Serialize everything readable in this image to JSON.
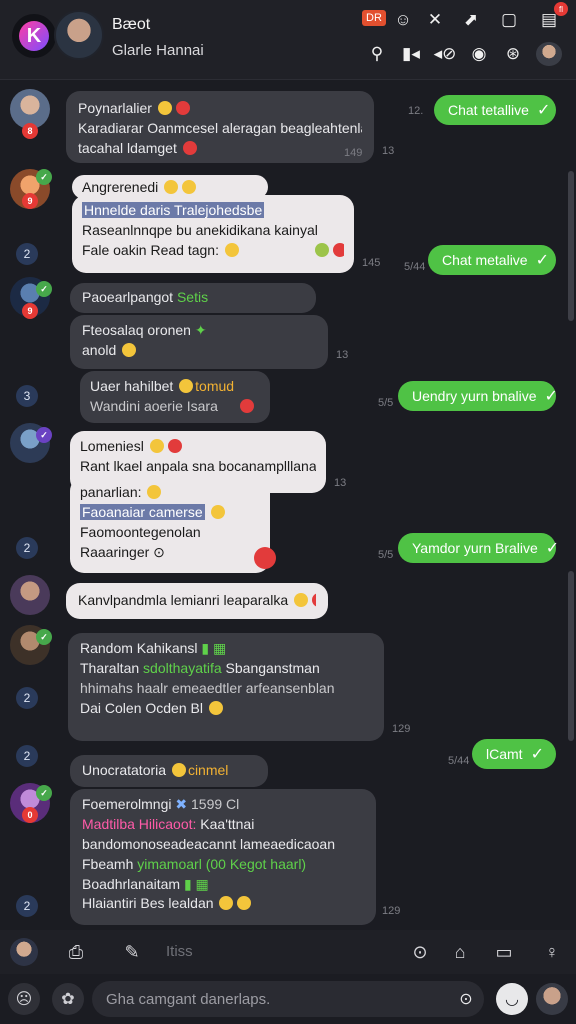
{
  "header": {
    "title": "Bæot",
    "subtitle": "Glarle Hannai",
    "tag": "DR",
    "notif_count": "fl",
    "icons": [
      "tag-icon",
      "emoji-icon",
      "tools-icon",
      "arrow-icon",
      "window-icon",
      "notification-icon",
      "search-icon",
      "video-icon",
      "mute-icon",
      "status-icon",
      "settings-icon",
      "profile-icon"
    ]
  },
  "messages": [
    {
      "name": "Poynarlalier",
      "lines": [
        "Karadiarar Oanmcesel aleragan beagleahtenlan",
        "tacahal ldamget"
      ],
      "time": "149"
    },
    {
      "name": "Angrerenedi",
      "lines": [
        "Hnnelde daris Tralejohedsbe",
        "Raseanlnnqpe bu anekidikana kainyal",
        "Fale oakin Read tagn:"
      ],
      "time": "145"
    },
    {
      "name": "Paoearlpangot",
      "extra": "Setis",
      "lines": [
        "Fteosalaq oronen",
        "anold"
      ],
      "time": "13"
    },
    {
      "name": "Uaer hahilbet",
      "extra": "tomud",
      "lines": [
        "Wandini aoerie Isara"
      ]
    },
    {
      "name": "Lomeniesl",
      "lines": [
        "Rant lkael anpala sna bocanamplllanal",
        "panarlian:",
        "Faoanaiar camerse"
      ],
      "time": "13"
    },
    {
      "name": "Faomoontegenolan",
      "lines": [
        "Raaaringer"
      ]
    },
    {
      "name": "Kanvlpandmla lemianri leaparalka",
      "lines": []
    },
    {
      "name": "Random Kahikansl",
      "lines": [
        "Tharaltan",
        "hhimahs haalr emeaedtler arfeansenblan",
        "Dai Colen Ocden Bl"
      ],
      "extra": "sdolthayatifa",
      "extra2": "Sbanganstman",
      "time": "129"
    },
    {
      "name": "Unocratatoria",
      "extra": "cinmel",
      "lines": []
    },
    {
      "name": "Foemerolmngi",
      "extra": "1599 Cl",
      "lines": [
        "Madtilba Hilicaoot:",
        "Kaa'ttnai",
        "bandomonoseadeacannt lameaedicaoan",
        "Fbeamh",
        "Boadhrlanaitam",
        "Hlaiantiri Bes lealdan"
      ],
      "extra2": "yimamoarl (00 Kegot haarl)",
      "time": "129"
    }
  ],
  "timestamps": [
    "12.",
    "13",
    "145",
    "5/44",
    "13",
    "5/5",
    "13",
    "5/5",
    "129",
    "5/44",
    "129"
  ],
  "outgoing": [
    {
      "text": "Chat tetallive"
    },
    {
      "text": "Chat metalive"
    },
    {
      "text": "Uendry yurn bnalive"
    },
    {
      "text": "Yamdor yurn Bralive"
    },
    {
      "text": "lCamt"
    }
  ],
  "left_badges": [
    "2",
    "3",
    "2",
    "2",
    "2",
    "2"
  ],
  "toolbar": {
    "label": "Itiss"
  },
  "composer": {
    "placeholder": "Gha camgant danerlaps."
  },
  "colors": {
    "accent_green": "#4fc245",
    "background": "#1b1c22",
    "light_bubble": "#ece8ea",
    "dark_bubble": "#3b3c43"
  }
}
